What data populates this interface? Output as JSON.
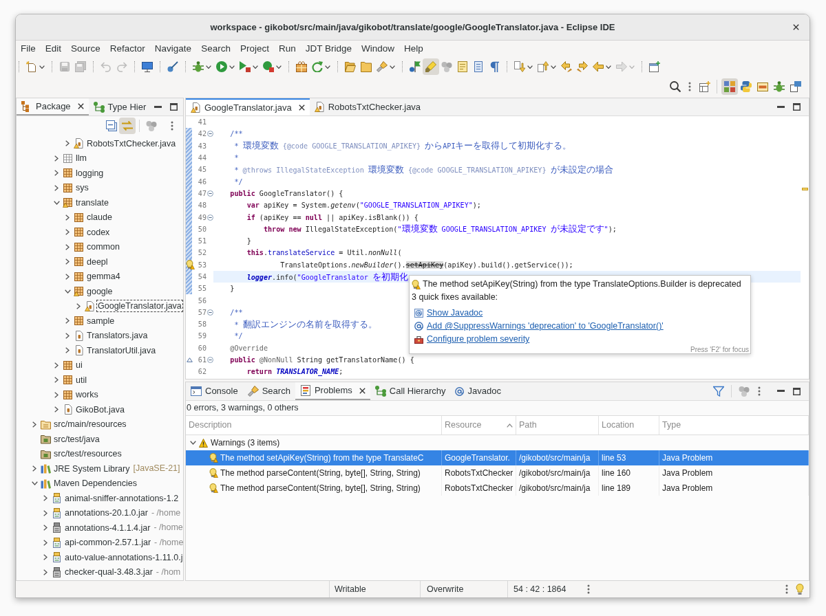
{
  "window": {
    "title": "workspace - gikobot/src/main/java/gikobot/translate/google/GoogleTranslator.java - Eclipse IDE"
  },
  "menu": [
    "File",
    "Edit",
    "Source",
    "Refactor",
    "Navigate",
    "Search",
    "Project",
    "Run",
    "JDT Bridge",
    "Window",
    "Help"
  ],
  "toolbar": [
    {
      "disabled": false,
      "pressed": false
    },
    {
      "disabled": true,
      "pressed": false
    },
    {
      "disabled": true,
      "pressed": false
    },
    {
      "disabled": true,
      "pressed": false
    },
    {
      "disabled": true,
      "pressed": false
    },
    {
      "disabled": false,
      "pressed": false
    },
    {
      "disabled": false,
      "pressed": false
    },
    {
      "disabled": false,
      "pressed": false
    },
    {
      "disabled": false,
      "pressed": false
    },
    {
      "disabled": false,
      "pressed": false
    },
    {
      "disabled": false,
      "pressed": false
    },
    {
      "disabled": false,
      "pressed": false
    },
    {
      "disabled": false,
      "pressed": false
    },
    {
      "disabled": false,
      "pressed": false
    },
    {
      "disabled": false,
      "pressed": false
    },
    {
      "disabled": false,
      "pressed": false
    },
    {
      "disabled": false,
      "pressed": false
    },
    {
      "disabled": false,
      "pressed": true
    },
    {
      "disabled": false,
      "pressed": false
    },
    {
      "disabled": false,
      "pressed": false
    },
    {
      "disabled": false,
      "pressed": false
    },
    {
      "disabled": false,
      "pressed": false
    },
    {
      "disabled": false,
      "pressed": false
    },
    {
      "disabled": false,
      "pressed": false
    },
    {
      "disabled": false,
      "pressed": false
    },
    {
      "disabled": false,
      "pressed": false
    },
    {
      "disabled": false,
      "pressed": false
    },
    {
      "disabled": true,
      "pressed": false
    },
    {
      "disabled": false,
      "pressed": false
    }
  ],
  "perspectives": [
    {
      "selected": true
    },
    {
      "selected": false
    },
    {
      "selected": false
    },
    {
      "selected": false
    },
    {
      "selected": false
    }
  ],
  "explorer": {
    "active": false,
    "tabs": [
      {
        "label": "Package",
        "selected": true
      },
      {
        "label": "Type Hier",
        "selected": false
      }
    ],
    "link_toggle": {
      "pressed": true
    },
    "tree": [
      {
        "children": [
          {
            "children": [
              {
                "children": [
                  {
                    "label": "RobotsTxtChecker.java",
                    "kind": "java-file",
                    "warning": true,
                    "expandable": true,
                    "expanded": false,
                    "selected": false
                  }
                ]
              },
              {
                "label": "llm",
                "kind": "empty-package",
                "warning": false,
                "expandable": true,
                "expanded": false,
                "selected": false
              },
              {
                "label": "logging",
                "kind": "package",
                "warning": false,
                "expandable": true,
                "expanded": false,
                "selected": false
              },
              {
                "label": "sys",
                "kind": "package",
                "warning": false,
                "expandable": true,
                "expanded": false,
                "selected": false
              },
              {
                "label": "translate",
                "kind": "package",
                "warning": true,
                "expandable": true,
                "expanded": true,
                "selected": false,
                "children": [
                  {
                    "label": "claude",
                    "kind": "package",
                    "warning": false,
                    "expandable": true,
                    "expanded": false,
                    "selected": false
                  },
                  {
                    "label": "codex",
                    "kind": "package",
                    "warning": false,
                    "expandable": true,
                    "expanded": false,
                    "selected": false
                  },
                  {
                    "label": "common",
                    "kind": "package",
                    "warning": false,
                    "expandable": true,
                    "expanded": false,
                    "selected": false
                  },
                  {
                    "label": "deepl",
                    "kind": "package",
                    "warning": false,
                    "expandable": true,
                    "expanded": false,
                    "selected": false
                  },
                  {
                    "label": "gemma4",
                    "kind": "package",
                    "warning": false,
                    "expandable": true,
                    "expanded": false,
                    "selected": false
                  },
                  {
                    "label": "google",
                    "kind": "package",
                    "warning": true,
                    "expandable": true,
                    "expanded": true,
                    "selected": false,
                    "children": [
                      {
                        "label": "GoogleTranslator.java",
                        "kind": "java-file",
                        "warning": true,
                        "expandable": true,
                        "expanded": false,
                        "selected": true
                      }
                    ]
                  },
                  {
                    "label": "sample",
                    "kind": "package",
                    "warning": false,
                    "expandable": true,
                    "expanded": false,
                    "selected": false
                  },
                  {
                    "label": "Translators.java",
                    "kind": "java-file",
                    "warning": false,
                    "expandable": true,
                    "expanded": false,
                    "selected": false
                  },
                  {
                    "label": "TranslatorUtil.java",
                    "kind": "java-file",
                    "warning": false,
                    "expandable": true,
                    "expanded": false,
                    "selected": false
                  }
                ]
              },
              {
                "label": "ui",
                "kind": "package",
                "warning": false,
                "expandable": true,
                "expanded": false,
                "selected": false
              },
              {
                "label": "util",
                "kind": "package",
                "warning": false,
                "expandable": true,
                "expanded": false,
                "selected": false
              },
              {
                "label": "works",
                "kind": "package",
                "warning": false,
                "expandable": true,
                "expanded": false,
                "selected": false
              },
              {
                "label": "GikoBot.java",
                "kind": "java-file",
                "warning": false,
                "expandable": true,
                "expanded": false,
                "selected": false
              }
            ]
          }
        ]
      },
      {
        "label": "src/main/resources",
        "kind": "resource-folder",
        "warning": false,
        "expandable": true,
        "expanded": false,
        "selected": false
      },
      {
        "label": "src/test/java",
        "kind": "source-folder",
        "warning": false,
        "expandable": false,
        "expanded": false,
        "selected": false
      },
      {
        "label": "src/test/resources",
        "kind": "source-folder",
        "warning": false,
        "expandable": false,
        "expanded": false,
        "selected": false
      },
      {
        "label": "JRE System Library",
        "kind": "library",
        "warning": false,
        "expandable": true,
        "expanded": false,
        "selected": false,
        "suffix": {
          "text": "[JavaSE-21]",
          "kind": "decoration"
        }
      },
      {
        "label": "Maven Dependencies",
        "kind": "library",
        "warning": false,
        "expandable": true,
        "expanded": true,
        "selected": false,
        "children": [
          {
            "label": "animal-sniffer-annotations-1.2",
            "kind": "jar",
            "warning": false,
            "expandable": true,
            "expanded": false,
            "selected": false
          },
          {
            "label": "annotations-20.1.0.jar",
            "kind": "jar",
            "warning": false,
            "expandable": true,
            "expanded": false,
            "selected": false,
            "suffix": {
              "text": "- /home",
              "kind": "qualifier"
            }
          },
          {
            "label": "annotations-4.1.1.4.jar",
            "kind": "jar-binary",
            "warning": false,
            "expandable": true,
            "expanded": false,
            "selected": false,
            "suffix": {
              "text": "- /home",
              "kind": "qualifier"
            }
          },
          {
            "label": "api-common-2.57.1.jar",
            "kind": "jar",
            "warning": false,
            "expandable": true,
            "expanded": false,
            "selected": false,
            "suffix": {
              "text": "- /home",
              "kind": "qualifier"
            }
          },
          {
            "label": "auto-value-annotations-1.11.0.j",
            "kind": "jar",
            "warning": false,
            "expandable": true,
            "expanded": false,
            "selected": false
          },
          {
            "label": "checker-qual-3.48.3.jar",
            "kind": "jar-binary",
            "warning": false,
            "expandable": true,
            "expanded": false,
            "selected": false,
            "suffix": {
              "text": "- /hom",
              "kind": "qualifier"
            }
          }
        ]
      }
    ]
  },
  "editor": {
    "active": true,
    "tabs": [
      {
        "label": "GoogleTranslator.java",
        "selected": true
      },
      {
        "label": "RobotsTxtChecker.java",
        "selected": false
      }
    ],
    "lines": [
      {
        "number": "41",
        "fold": false,
        "changed": false,
        "current": false,
        "warning": false,
        "override": false
      },
      {
        "number": "42",
        "fold": true,
        "changed": true,
        "current": false,
        "warning": false,
        "override": false,
        "tokens": [
          {
            "text": "    /**",
            "kind": "comment"
          }
        ]
      },
      {
        "number": "43",
        "fold": false,
        "changed": true,
        "current": false,
        "warning": false,
        "override": false,
        "tokens": [
          {
            "text": "     * 環境変数 ",
            "kind": "comment"
          },
          {
            "text": "{@code GOOGLE_TRANSLATION_APIKEY}",
            "kind": "doc-tag"
          },
          {
            "text": " からAPIキーを取得して初期化する。",
            "kind": "comment"
          }
        ]
      },
      {
        "number": "44",
        "fold": false,
        "changed": true,
        "current": false,
        "warning": false,
        "override": false,
        "tokens": [
          {
            "text": "     *",
            "kind": "comment"
          }
        ]
      },
      {
        "number": "45",
        "fold": false,
        "changed": true,
        "current": false,
        "warning": false,
        "override": false,
        "tokens": [
          {
            "text": "     * ",
            "kind": "comment"
          },
          {
            "text": "@throws IllegalStateException",
            "kind": "doc-tag"
          },
          {
            "text": " 環境変数 ",
            "kind": "comment"
          },
          {
            "text": "{@code GOOGLE_TRANSLATION_APIKEY}",
            "kind": "doc-tag"
          },
          {
            "text": " が未設定の場合",
            "kind": "comment"
          }
        ]
      },
      {
        "number": "46",
        "fold": false,
        "changed": true,
        "current": false,
        "warning": false,
        "override": false,
        "tokens": [
          {
            "text": "     */",
            "kind": "comment"
          }
        ]
      },
      {
        "number": "47",
        "fold": true,
        "changed": true,
        "current": false,
        "warning": false,
        "override": false,
        "tokens": [
          {
            "text": "    public",
            "kind": "keyword"
          },
          {
            "text": " GoogleTranslator() {",
            "kind": "plain"
          }
        ]
      },
      {
        "number": "48",
        "fold": false,
        "changed": true,
        "current": false,
        "warning": false,
        "override": false,
        "tokens": [
          {
            "text": "        var",
            "kind": "keyword"
          },
          {
            "text": " apiKey = System.",
            "kind": "plain"
          },
          {
            "text": "getenv",
            "kind": "static-method"
          },
          {
            "text": "(",
            "kind": "plain"
          },
          {
            "text": "\"GOOGLE_TRANSLATION_APIKEY\"",
            "kind": "string"
          },
          {
            "text": ");",
            "kind": "plain"
          }
        ]
      },
      {
        "number": "49",
        "fold": true,
        "changed": true,
        "current": false,
        "warning": false,
        "override": false,
        "tokens": [
          {
            "text": "        if",
            "kind": "keyword"
          },
          {
            "text": " (apiKey == ",
            "kind": "plain"
          },
          {
            "text": "null",
            "kind": "keyword"
          },
          {
            "text": " || apiKey.isBlank()) {",
            "kind": "plain"
          }
        ]
      },
      {
        "number": "50",
        "fold": false,
        "changed": true,
        "current": false,
        "warning": false,
        "override": false,
        "tokens": [
          {
            "text": "            throw new",
            "kind": "keyword"
          },
          {
            "text": " IllegalStateException(",
            "kind": "plain"
          },
          {
            "text": "\"環境変数 GOOGLE_TRANSLATION_APIKEY が未設定です\"",
            "kind": "string"
          },
          {
            "text": ");",
            "kind": "plain"
          }
        ]
      },
      {
        "number": "51",
        "fold": false,
        "changed": true,
        "current": false,
        "warning": false,
        "override": false,
        "tokens": [
          {
            "text": "        }",
            "kind": "plain"
          }
        ]
      },
      {
        "number": "52",
        "fold": false,
        "changed": true,
        "current": false,
        "warning": false,
        "override": false,
        "tokens": [
          {
            "text": "        this",
            "kind": "keyword"
          },
          {
            "text": ".",
            "kind": "plain"
          },
          {
            "text": "translateService",
            "kind": "field"
          },
          {
            "text": " = Util.",
            "kind": "plain"
          },
          {
            "text": "nonNull",
            "kind": "static-method"
          },
          {
            "text": "(",
            "kind": "plain"
          }
        ]
      },
      {
        "number": "53",
        "fold": false,
        "changed": true,
        "current": false,
        "warning": true,
        "override": false,
        "tokens": [
          {
            "text": "                TranslateOptions.",
            "kind": "plain"
          },
          {
            "text": "newBuilder",
            "kind": "static-method"
          },
          {
            "text": "().",
            "kind": "plain"
          },
          {
            "text": "setApiKey",
            "kind": "deprecated"
          },
          {
            "text": "(apiKey).build().getService());",
            "kind": "plain"
          }
        ]
      },
      {
        "number": "54",
        "fold": false,
        "changed": true,
        "current": true,
        "warning": false,
        "override": false,
        "tokens": [
          {
            "text": "        logger",
            "kind": "static-field"
          },
          {
            "text": ".info(",
            "kind": "plain"
          },
          {
            "text": "\"GoogleTranslator を初期化",
            "kind": "string"
          }
        ]
      },
      {
        "number": "55",
        "fold": false,
        "changed": true,
        "current": false,
        "warning": false,
        "override": false,
        "tokens": [
          {
            "text": "    }",
            "kind": "plain"
          }
        ]
      },
      {
        "number": "56",
        "fold": false,
        "changed": false,
        "current": false,
        "warning": false,
        "override": false
      },
      {
        "number": "57",
        "fold": true,
        "changed": false,
        "current": false,
        "warning": false,
        "override": false,
        "tokens": [
          {
            "text": "    /**",
            "kind": "comment"
          }
        ]
      },
      {
        "number": "58",
        "fold": false,
        "changed": false,
        "current": false,
        "warning": false,
        "override": false,
        "tokens": [
          {
            "text": "     * 翻訳エンジンの名前を取得する。",
            "kind": "comment"
          }
        ]
      },
      {
        "number": "59",
        "fold": false,
        "changed": false,
        "current": false,
        "warning": false,
        "override": false,
        "tokens": [
          {
            "text": "     */",
            "kind": "comment"
          }
        ]
      },
      {
        "number": "60",
        "fold": false,
        "changed": false,
        "current": false,
        "warning": false,
        "override": false,
        "tokens": [
          {
            "text": "    @Override",
            "kind": "annotation"
          }
        ]
      },
      {
        "number": "61",
        "fold": true,
        "changed": false,
        "current": false,
        "warning": false,
        "override": true,
        "tokens": [
          {
            "text": "    public",
            "kind": "keyword"
          },
          {
            "text": " @NonNull",
            "kind": "annotation"
          },
          {
            "text": " String getTranslatorName() {",
            "kind": "plain"
          }
        ]
      },
      {
        "number": "62",
        "fold": false,
        "changed": false,
        "current": false,
        "warning": false,
        "override": false,
        "tokens": [
          {
            "text": "        return",
            "kind": "keyword"
          },
          {
            "text": " TRANSLATOR_NAME",
            "kind": "static-field"
          },
          {
            "text": ";",
            "kind": "plain"
          }
        ]
      }
    ],
    "hover": {
      "message": "The method setApiKey(String) from the type TranslateOptions.Builder is deprecated",
      "subtitle": "3 quick fixes available:",
      "fixes": [
        {
          "label": "Show Javadoc",
          "kind": "javadoc"
        },
        {
          "label": "Add @SuppressWarnings 'deprecation' to 'GoogleTranslator()'",
          "kind": "annotation"
        },
        {
          "label": "Configure problem severity",
          "kind": "severity"
        }
      ],
      "footer": "Press 'F2' for focus"
    }
  },
  "problems": {
    "active": false,
    "tabs": [
      {
        "label": "Console",
        "selected": false
      },
      {
        "label": "Search",
        "selected": false
      },
      {
        "label": "Problems",
        "selected": true
      },
      {
        "label": "Call Hierarchy",
        "selected": false
      },
      {
        "label": "Javadoc",
        "selected": false
      }
    ],
    "summary": "0 errors, 3 warnings, 0 others",
    "columns": [
      {
        "label": "Description",
        "sorted": false
      },
      {
        "label": "Resource",
        "sorted": true
      },
      {
        "label": "Path",
        "sorted": false
      },
      {
        "label": "Location",
        "sorted": false
      },
      {
        "label": "Type",
        "sorted": false
      }
    ],
    "groups": [
      {
        "label": "Warnings (3 items)",
        "expanded": true,
        "rows": [
          {
            "cells": [
              "The method setApiKey(String) from the type TranslateC",
              "GoogleTranslator.",
              "/gikobot/src/main/ja",
              "line 53",
              "Java Problem"
            ],
            "selected": true
          },
          {
            "cells": [
              "The method parseContent(String, byte[], String, String)",
              "RobotsTxtChecker",
              "/gikobot/src/main/ja",
              "line 160",
              "Java Problem"
            ],
            "selected": false
          },
          {
            "cells": [
              "The method parseContent(String, byte[], String, String)",
              "RobotsTxtChecker",
              "/gikobot/src/main/ja",
              "line 189",
              "Java Problem"
            ],
            "selected": false
          }
        ]
      }
    ]
  },
  "status_bar": {
    "fields": [
      "Writable",
      "Overwrite",
      "54 : 42 : 1864"
    ]
  }
}
